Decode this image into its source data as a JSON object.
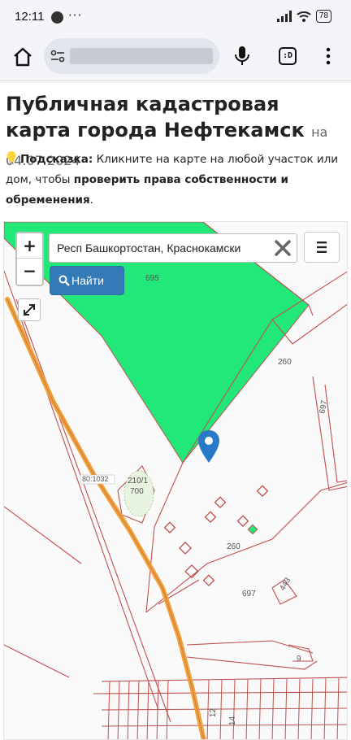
{
  "status_bar": {
    "time": "12:11",
    "more": "···",
    "battery": "78"
  },
  "toolbar": {
    "tabs_label": ":D"
  },
  "page": {
    "title": "Публичная кадастровая карта города Нефтекамск",
    "date": "на 04.07.2024",
    "hint_label": "Подсказка:",
    "hint_text": " Кликните на карте на любой участок или дом, чтобы ",
    "hint_bold": "проверить права собственности и обременения",
    "hint_end": "."
  },
  "map": {
    "search_value": "Респ Башкортостан, Краснокамски",
    "find_label": "Найти",
    "labels": {
      "l695": "695",
      "l260a": "260",
      "l697a": "697",
      "lroad": "80:1032",
      "l210": "210/1",
      "l700": "700",
      "l260b": "260",
      "l697b": "697",
      "l443": "443",
      "l9": "9",
      "l12": "12",
      "l14": "14"
    },
    "colors": {
      "green_parcel": "#22e87a",
      "parcel_border": "#c0504d",
      "road": "#f0a23a",
      "marker": "#2979c9"
    }
  }
}
